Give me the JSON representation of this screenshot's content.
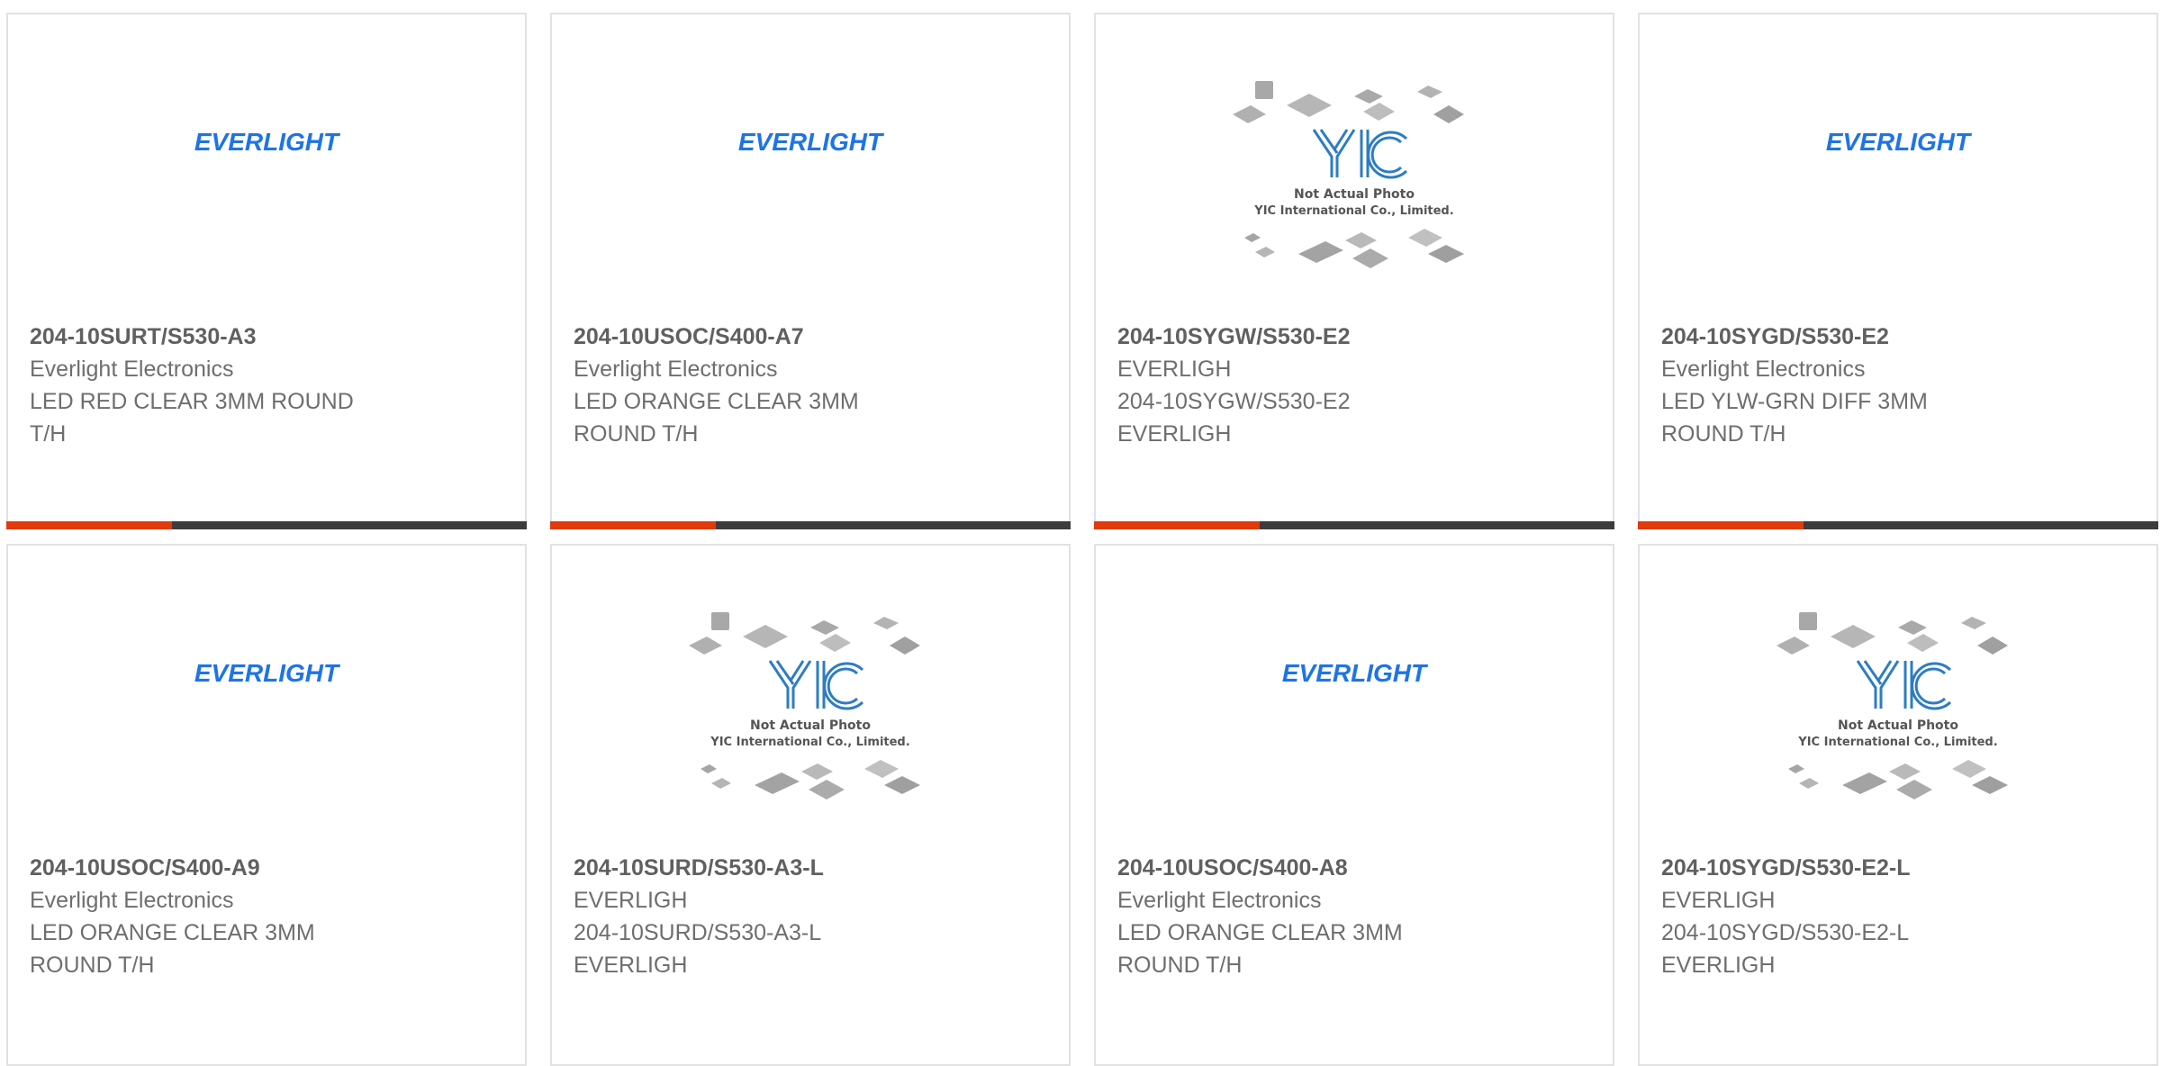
{
  "brand": {
    "everlight_logo_text": "EVERLIGHT",
    "everlight_color": "#1e74e6",
    "accent_color": "#e03a0e",
    "bar_color": "#3c3c3c"
  },
  "placeholder": {
    "logo_text": "YIC",
    "line1": "Not Actual Photo",
    "line2": "YIC International Co., Limited."
  },
  "products": [
    {
      "part": "204-10SURT/S530-A3",
      "mfr": "Everlight Electronics",
      "desc_line1": "LED RED CLEAR 3MM ROUND",
      "desc_line2": "T/H",
      "image": "everlight-logo"
    },
    {
      "part": "204-10USOC/S400-A7",
      "mfr": "Everlight Electronics",
      "desc_line1": "LED ORANGE CLEAR 3MM",
      "desc_line2": "ROUND T/H",
      "image": "everlight-logo"
    },
    {
      "part": "204-10SYGW/S530-E2",
      "mfr": "EVERLIGH",
      "desc_line1": "204-10SYGW/S530-E2",
      "desc_line2": "EVERLIGH",
      "image": "yic-placeholder"
    },
    {
      "part": "204-10SYGD/S530-E2",
      "mfr": "Everlight Electronics",
      "desc_line1": "LED YLW-GRN DIFF 3MM",
      "desc_line2": "ROUND T/H",
      "image": "everlight-logo"
    },
    {
      "part": "204-10USOC/S400-A9",
      "mfr": "Everlight Electronics",
      "desc_line1": "LED ORANGE CLEAR 3MM",
      "desc_line2": "ROUND T/H",
      "image": "everlight-logo"
    },
    {
      "part": "204-10SURD/S530-A3-L",
      "mfr": "EVERLIGH",
      "desc_line1": "204-10SURD/S530-A3-L",
      "desc_line2": "EVERLIGH",
      "image": "yic-placeholder"
    },
    {
      "part": "204-10USOC/S400-A8",
      "mfr": "Everlight Electronics",
      "desc_line1": "LED ORANGE CLEAR 3MM",
      "desc_line2": "ROUND T/H",
      "image": "everlight-logo"
    },
    {
      "part": "204-10SYGD/S530-E2-L",
      "mfr": "EVERLIGH",
      "desc_line1": "204-10SYGD/S530-E2-L",
      "desc_line2": "EVERLIGH",
      "image": "yic-placeholder"
    }
  ]
}
